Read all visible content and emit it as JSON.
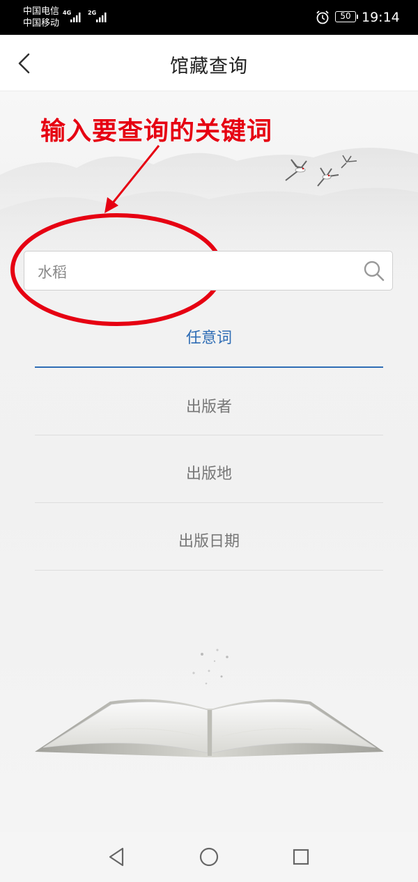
{
  "status": {
    "carrier1": "中国电信",
    "carrier2": "中国移动",
    "net1": "4G",
    "net2": "2G",
    "battery": "50",
    "time": "19:14"
  },
  "header": {
    "title": "馆藏查询"
  },
  "annotation": {
    "text": "输入要查询的关键词",
    "color": "#e60012"
  },
  "search": {
    "value": "水稻"
  },
  "tabs": [
    {
      "label": "任意词",
      "active": true
    },
    {
      "label": "出版者",
      "active": false
    },
    {
      "label": "出版地",
      "active": false
    },
    {
      "label": "出版日期",
      "active": false
    }
  ],
  "colors": {
    "accent": "#2f6db5",
    "annotation_red": "#e60012"
  },
  "icons": [
    "back-chevron-icon",
    "search-icon",
    "alarm-icon",
    "nav-back-icon",
    "nav-home-icon",
    "nav-recents-icon"
  ]
}
